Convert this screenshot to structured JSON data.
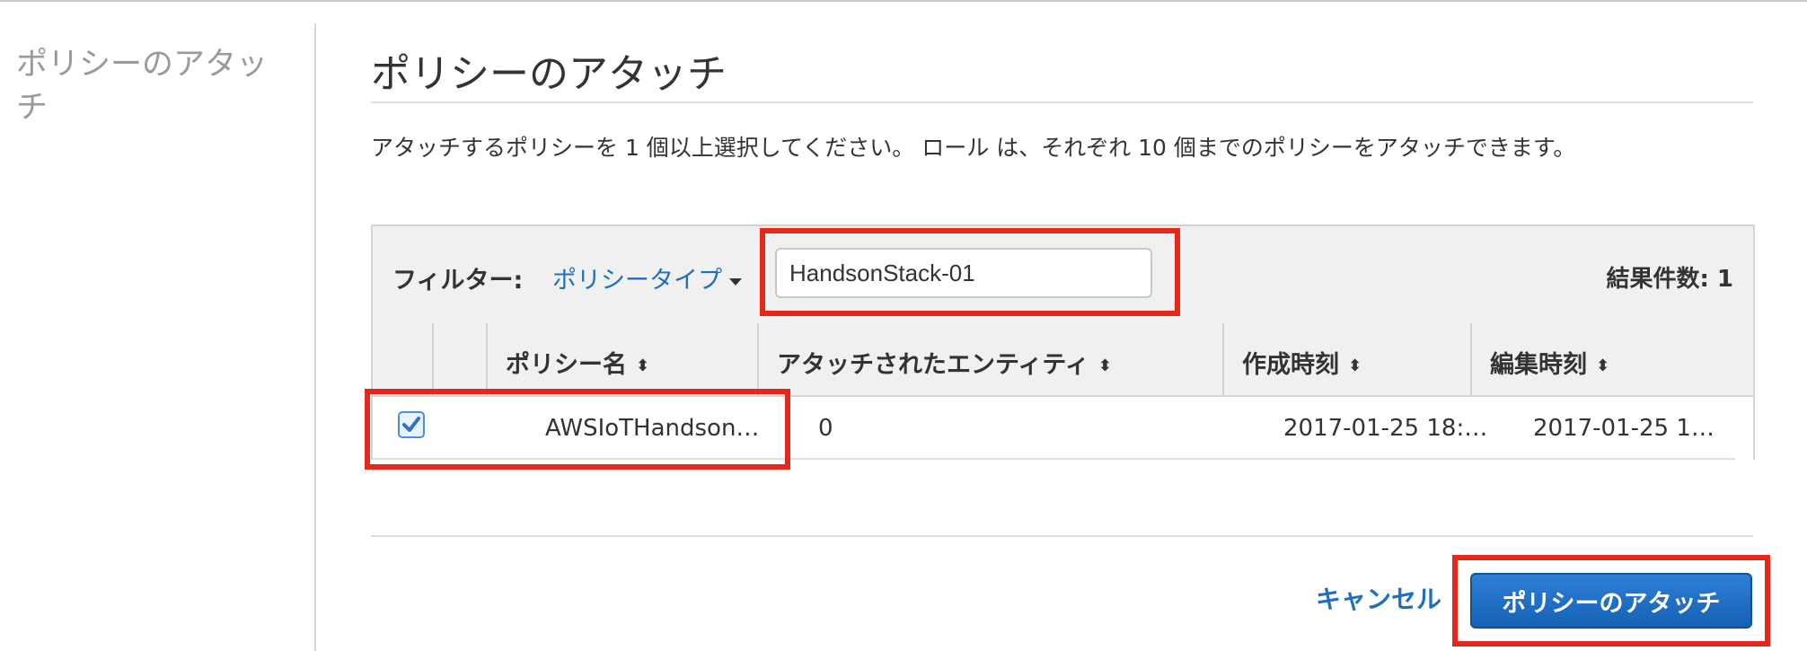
{
  "sidebar": {
    "title": "ポリシーのアタッチ"
  },
  "main": {
    "title": "ポリシーのアタッチ",
    "description": "アタッチするポリシーを 1 個以上選択してください。 ロール は、それぞれ 10 個までのポリシーをアタッチできます。"
  },
  "filter": {
    "label": "フィルター:",
    "policy_type": "ポリシータイプ",
    "search_value": "HandsonStack-01",
    "result_count": "結果件数: 1"
  },
  "table": {
    "columns": [
      "ポリシー名",
      "アタッチされたエンティティ",
      "作成時刻",
      "編集時刻"
    ],
    "sort_glyph": "⬍",
    "rows": [
      {
        "checked": true,
        "policy_name": "AWSIoTHandson…",
        "attached_entities": "0",
        "created": "2017-01-25 18:…",
        "edited": "2017-01-25 1…"
      }
    ]
  },
  "actions": {
    "cancel_label": "キャンセル",
    "attach_label": "ポリシーのアタッチ"
  },
  "colors": {
    "link": "#1e6fbf",
    "primary_button": "#1a6bc4",
    "highlight": "#e8271c"
  }
}
